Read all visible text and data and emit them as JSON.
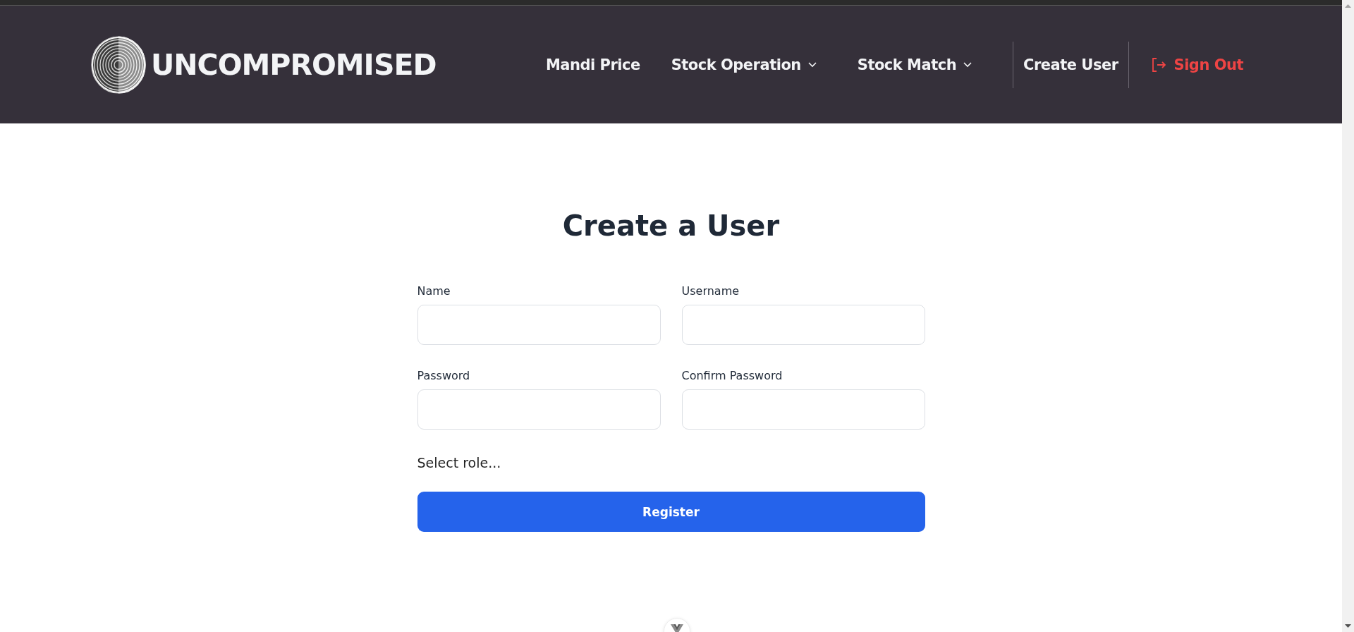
{
  "header": {
    "brand": "UNCOMPROMISED",
    "nav": [
      {
        "label": "Mandi Price",
        "kind": "link"
      },
      {
        "label": "Stock Operation",
        "kind": "dropdown"
      },
      {
        "label": "Stock Match",
        "kind": "dropdown"
      },
      {
        "label": "Create User",
        "kind": "boxed"
      },
      {
        "label": "Sign Out",
        "kind": "signout"
      }
    ]
  },
  "form": {
    "title": "Create a User",
    "fields": [
      {
        "label": "Name"
      },
      {
        "label": "Username"
      },
      {
        "label": "Password"
      },
      {
        "label": "Confirm Password"
      }
    ],
    "role_select": {
      "placeholder": "Select role..."
    },
    "submit": "Register"
  }
}
